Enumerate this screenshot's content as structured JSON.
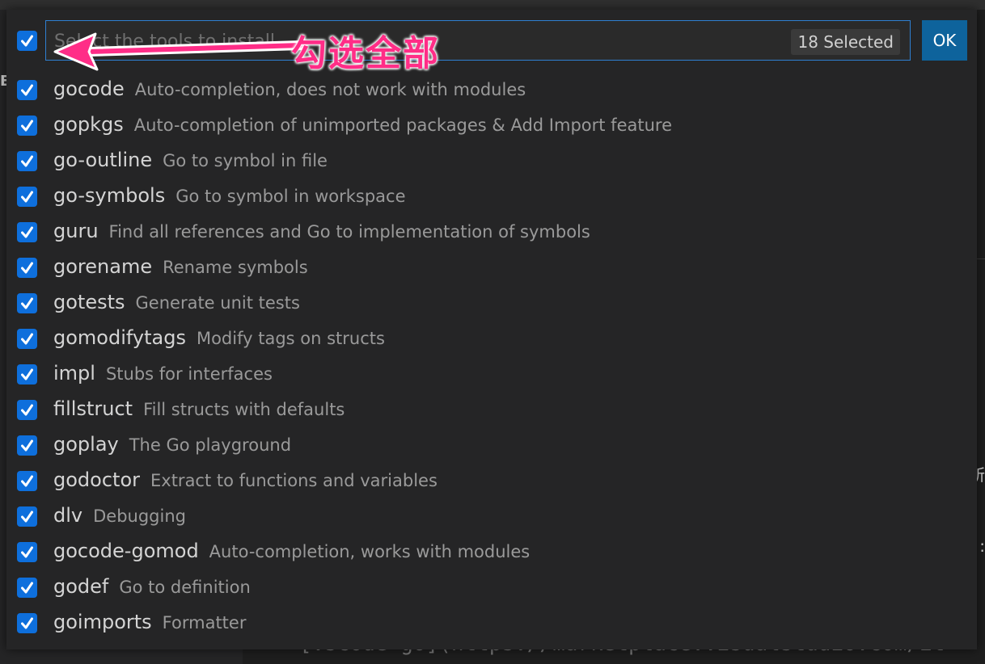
{
  "background": {
    "sidebar_hint": "E",
    "editor_char_a": "所",
    "editor_char_b": ":",
    "code_line": "[vscode-go](https://marketplace.visualstudio.com/it"
  },
  "picker": {
    "placeholder": "Select the tools to install",
    "selected_count": "18 Selected",
    "ok_label": "OK",
    "annotation": "勾选全部",
    "accent_color": "#0e6fdc",
    "annotation_color": "#ff2d87",
    "items": [
      {
        "name": "gocode",
        "description": "Auto-completion, does not work with modules",
        "checked": true
      },
      {
        "name": "gopkgs",
        "description": "Auto-completion of unimported packages & Add Import feature",
        "checked": true
      },
      {
        "name": "go-outline",
        "description": "Go to symbol in file",
        "checked": true
      },
      {
        "name": "go-symbols",
        "description": "Go to symbol in workspace",
        "checked": true
      },
      {
        "name": "guru",
        "description": "Find all references and Go to implementation of symbols",
        "checked": true
      },
      {
        "name": "gorename",
        "description": "Rename symbols",
        "checked": true
      },
      {
        "name": "gotests",
        "description": "Generate unit tests",
        "checked": true
      },
      {
        "name": "gomodifytags",
        "description": "Modify tags on structs",
        "checked": true
      },
      {
        "name": "impl",
        "description": "Stubs for interfaces",
        "checked": true
      },
      {
        "name": "fillstruct",
        "description": "Fill structs with defaults",
        "checked": true
      },
      {
        "name": "goplay",
        "description": "The Go playground",
        "checked": true
      },
      {
        "name": "godoctor",
        "description": "Extract to functions and variables",
        "checked": true
      },
      {
        "name": "dlv",
        "description": "Debugging",
        "checked": true
      },
      {
        "name": "gocode-gomod",
        "description": "Auto-completion, works with modules",
        "checked": true
      },
      {
        "name": "godef",
        "description": "Go to definition",
        "checked": true
      },
      {
        "name": "goimports",
        "description": "Formatter",
        "checked": true
      }
    ]
  }
}
